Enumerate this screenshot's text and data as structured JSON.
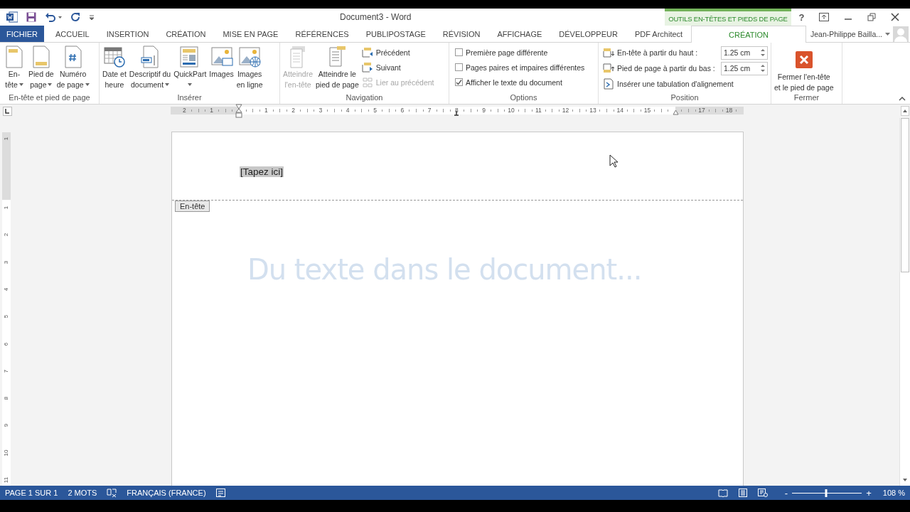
{
  "window": {
    "title": "Document3 - Word",
    "context_header": "OUTILS EN-TÊTES ET PIEDS DE PAGE",
    "help": "?"
  },
  "tabs": [
    {
      "label": "FICHIER",
      "kind": "file",
      "selected": false
    },
    {
      "label": "ACCUEIL",
      "kind": "tab",
      "selected": false
    },
    {
      "label": "INSERTION",
      "kind": "tab",
      "selected": false
    },
    {
      "label": "CRÉATION",
      "kind": "tab",
      "selected": false
    },
    {
      "label": "MISE EN PAGE",
      "kind": "tab",
      "selected": false
    },
    {
      "label": "RÉFÉRENCES",
      "kind": "tab",
      "selected": false
    },
    {
      "label": "PUBLIPOSTAGE",
      "kind": "tab",
      "selected": false
    },
    {
      "label": "RÉVISION",
      "kind": "tab",
      "selected": false
    },
    {
      "label": "AFFICHAGE",
      "kind": "tab",
      "selected": false
    },
    {
      "label": "DÉVELOPPEUR",
      "kind": "tab",
      "selected": false
    },
    {
      "label": "PDF Architect",
      "kind": "tab",
      "selected": false
    },
    {
      "label": "CRÉATION",
      "kind": "contextual",
      "selected": true
    }
  ],
  "account": {
    "name": "Jean-Philippe Bailla..."
  },
  "ribbon": {
    "groups": [
      {
        "title": "En-tête et pied de page",
        "items": [
          {
            "kind": "large",
            "lines": [
              "En-",
              "tête"
            ],
            "dropdown": true,
            "disabled": false
          },
          {
            "kind": "large",
            "lines": [
              "Pied de",
              "page"
            ],
            "dropdown": true,
            "disabled": false
          },
          {
            "kind": "large",
            "lines": [
              "Numéro",
              "de page"
            ],
            "dropdown": true,
            "disabled": false
          }
        ]
      },
      {
        "title": "Insérer",
        "items": [
          {
            "kind": "large",
            "lines": [
              "Date et",
              "heure"
            ],
            "dropdown": false,
            "disabled": false
          },
          {
            "kind": "large",
            "lines": [
              "Descriptif du",
              "document"
            ],
            "dropdown": true,
            "disabled": false
          },
          {
            "kind": "large",
            "lines": [
              "QuickPart"
            ],
            "dropdown": true,
            "disabled": false
          },
          {
            "kind": "large",
            "lines": [
              "Images"
            ],
            "dropdown": false,
            "disabled": false
          },
          {
            "kind": "large",
            "lines": [
              "Images",
              "en ligne"
            ],
            "dropdown": false,
            "disabled": false
          }
        ]
      },
      {
        "title": "Navigation",
        "items": [
          {
            "kind": "large",
            "lines": [
              "Atteindre",
              "l'en-tête"
            ],
            "dropdown": false,
            "disabled": true
          },
          {
            "kind": "large",
            "lines": [
              "Atteindre le",
              "pied de page"
            ],
            "dropdown": false,
            "disabled": false
          },
          {
            "kind": "small",
            "label": "Précédent",
            "disabled": false
          },
          {
            "kind": "small",
            "label": "Suivant",
            "disabled": false
          },
          {
            "kind": "small",
            "label": "Lier au précédent",
            "disabled": true
          }
        ]
      },
      {
        "title": "Options",
        "items": [
          {
            "kind": "checkbox",
            "label": "Première page différente",
            "checked": false
          },
          {
            "kind": "checkbox",
            "label": "Pages paires et impaires différentes",
            "checked": false
          },
          {
            "kind": "checkbox",
            "label": "Afficher le texte du document",
            "checked": true
          }
        ]
      },
      {
        "title": "Position",
        "items": [
          {
            "kind": "spin",
            "label": "En-tête à partir du haut :",
            "value": "1.25 cm"
          },
          {
            "kind": "spin",
            "label": "Pied de page à partir du bas :",
            "value": "1.25 cm"
          },
          {
            "kind": "small",
            "label": "Insérer une tabulation d'alignement",
            "disabled": false
          }
        ]
      },
      {
        "title": "Fermer",
        "items": [
          {
            "kind": "large",
            "lines": [
              "Fermer l'en-tête",
              "et le pied de page"
            ],
            "dropdown": false,
            "disabled": false
          }
        ]
      }
    ]
  },
  "ruler": {
    "numbers": [
      "2",
      "1",
      "1",
      "2",
      "3",
      "4",
      "5",
      "6",
      "7",
      "8",
      "9",
      "10",
      "11",
      "12",
      "13",
      "14",
      "15",
      "17",
      "18"
    ]
  },
  "vertical_ruler": {
    "numbers": [
      "1",
      "1",
      "2",
      "3",
      "4",
      "5",
      "6",
      "7",
      "8",
      "9",
      "10",
      "11"
    ]
  },
  "document": {
    "header_placeholder": "[Tapez ici]",
    "header_tag": "En-tête",
    "body_text": "Du texte dans le document..."
  },
  "status_bar": {
    "page": "PAGE 1 SUR 1",
    "words": "2 MOTS",
    "language": "FRANÇAIS (FRANCE)",
    "zoom": {
      "minus": "-",
      "plus": "+",
      "level": 0.49,
      "reading": "108 %"
    }
  }
}
